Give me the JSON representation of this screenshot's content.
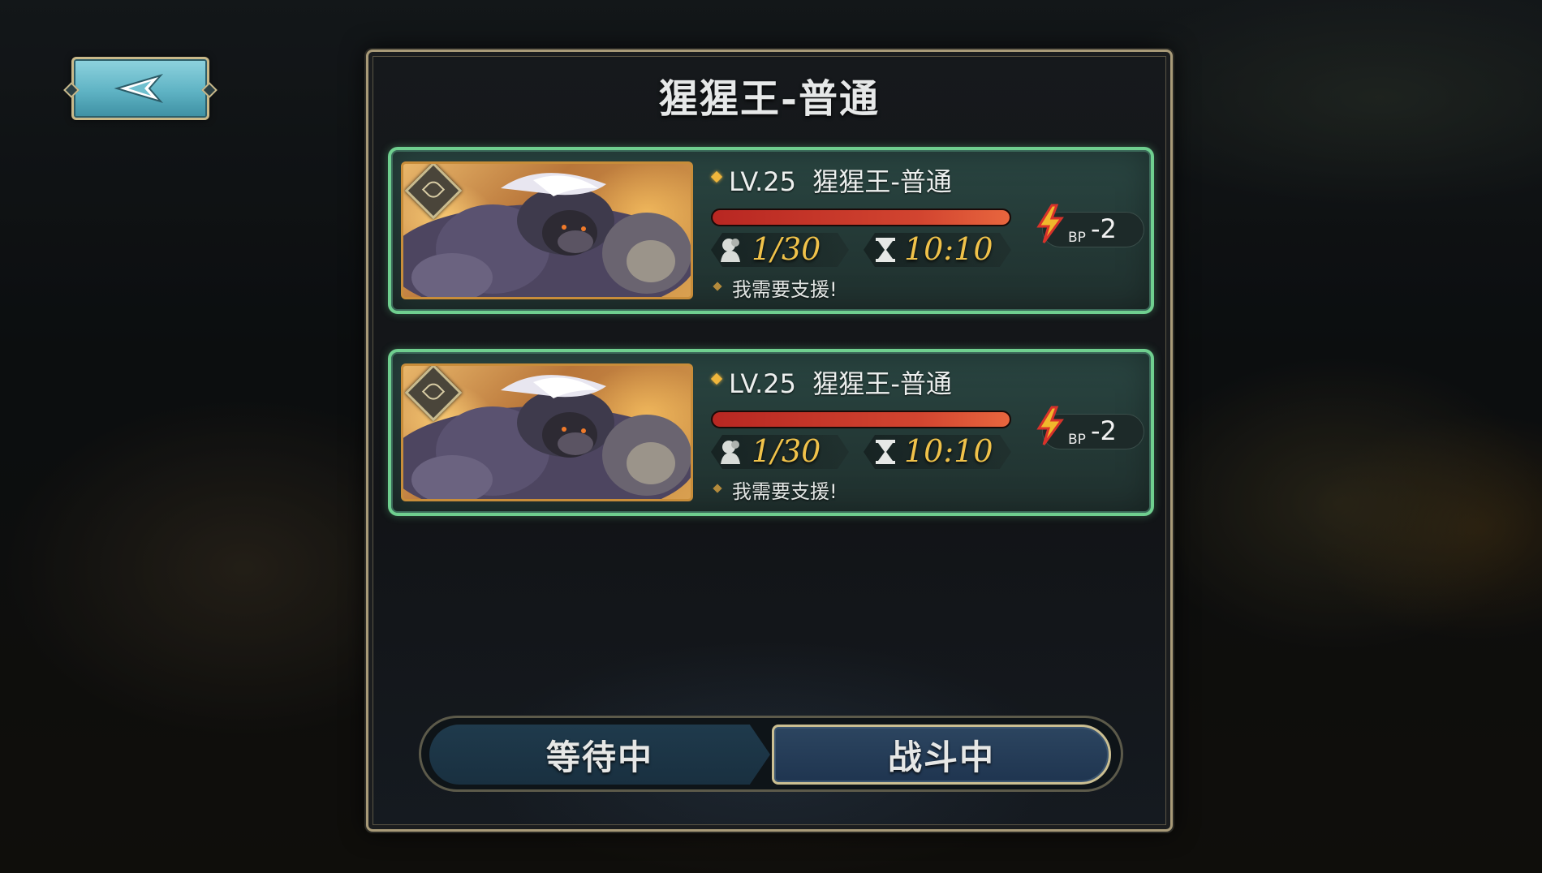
{
  "panel": {
    "title": "猩猩王-普通"
  },
  "raids": [
    {
      "name": "LV.25  猩猩王-普通",
      "hp_fraction": 1.0,
      "participants": "1/30",
      "time_left": "10:10",
      "bp_label": "BP",
      "bp_cost": "-2",
      "message": "我需要支援!"
    },
    {
      "name": "LV.25  猩猩王-普通",
      "hp_fraction": 1.0,
      "participants": "1/30",
      "time_left": "10:10",
      "bp_label": "BP",
      "bp_cost": "-2",
      "message": "我需要支援!"
    }
  ],
  "tabs": {
    "waiting": "等待中",
    "fighting": "战斗中",
    "active": "fighting"
  },
  "colors": {
    "card_border": "#6fcf8f",
    "hp_bar": "#d24530",
    "stat_text": "#f0c24a",
    "active_tab_border": "#cbbf92"
  }
}
